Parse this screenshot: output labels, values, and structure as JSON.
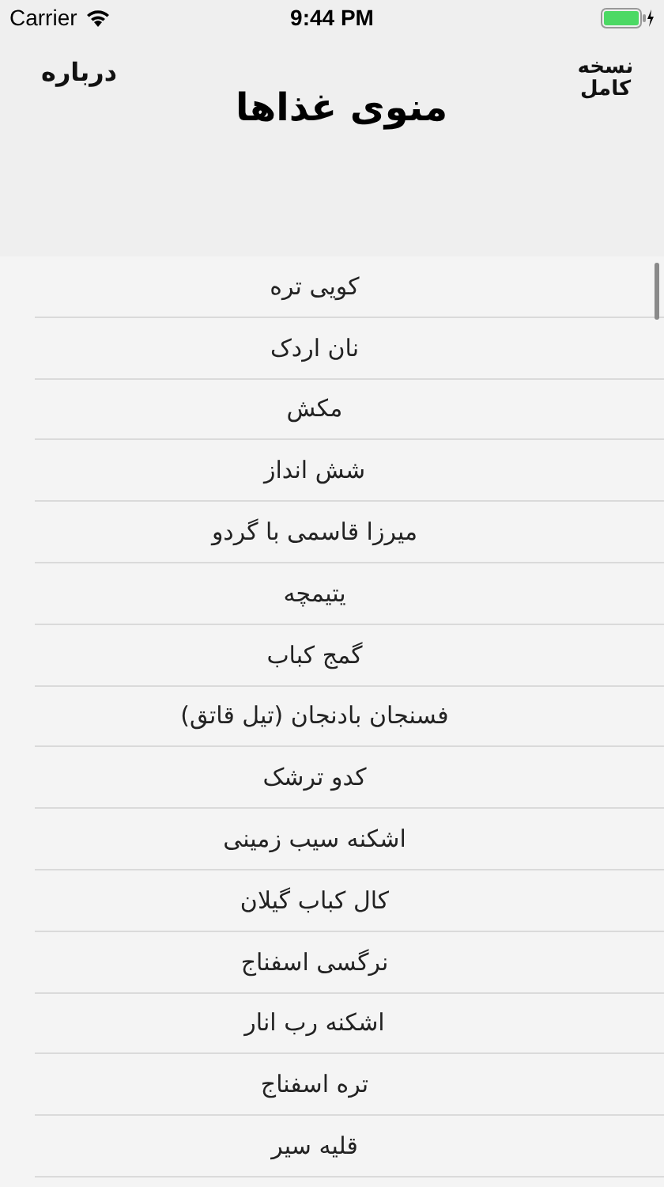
{
  "status_bar": {
    "carrier": "Carrier",
    "time": "9:44 PM"
  },
  "header": {
    "left_button": "درباره",
    "title": "منوی غذاها",
    "right_button": "نسخه کامل"
  },
  "items": [
    "کویی تره",
    "نان اردک",
    "مکش",
    "شش انداز",
    "میرزا قاسمی با گردو",
    "یتیمچه",
    "گمج کباب",
    "فسنجان بادنجان (تیل قاتق)",
    "کدو ترشک",
    "اشکنه سیب زمینی",
    "کال کباب گیلان",
    "نرگسی اسفناج",
    "اشکنه رب انار",
    "تره اسفناج",
    "قلیه سیر"
  ]
}
